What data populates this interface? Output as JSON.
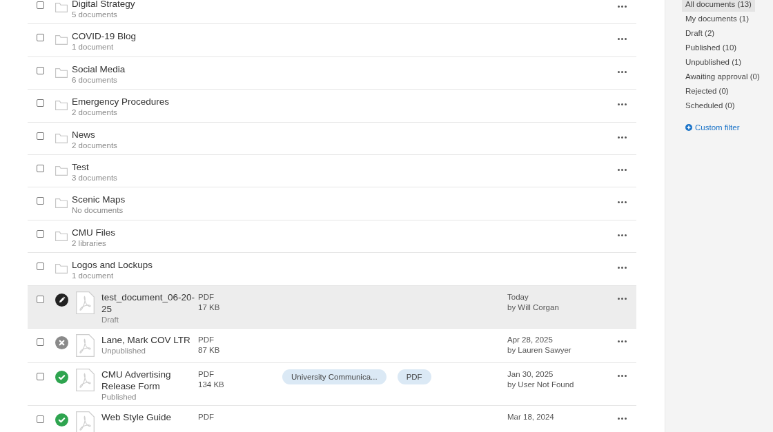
{
  "rows": [
    {
      "kind": "folder",
      "name": "Digital Strategy",
      "detail": "5 documents",
      "checked": false
    },
    {
      "kind": "folder",
      "name": "COVID-19 Blog",
      "detail": "1 document",
      "checked": false
    },
    {
      "kind": "folder",
      "name": "Social Media",
      "detail": "6 documents",
      "checked": false
    },
    {
      "kind": "folder",
      "name": "Emergency Procedures",
      "detail": "2 documents",
      "checked": false
    },
    {
      "kind": "folder",
      "name": "News",
      "detail": "2 documents",
      "checked": false
    },
    {
      "kind": "folder",
      "name": "Test",
      "detail": "3 documents",
      "checked": false
    },
    {
      "kind": "folder",
      "name": "Scenic Maps",
      "detail": "No documents",
      "checked": false
    },
    {
      "kind": "folder",
      "name": "CMU Files",
      "detail": "2 libraries",
      "checked": false
    },
    {
      "kind": "folder",
      "name": "Logos and Lockups",
      "detail": "1 document",
      "checked": false
    },
    {
      "kind": "draft",
      "name": "test_document_06-20-25",
      "detail": "Draft",
      "type": "PDF",
      "size": "17 KB",
      "tags": [],
      "date": "Today",
      "author": "by Will Corgan",
      "checked": false,
      "highlighted": true
    },
    {
      "kind": "unpublished",
      "name": "Lane, Mark COV LTR",
      "detail": "Unpublished",
      "type": "PDF",
      "size": "87 KB",
      "tags": [],
      "date": "Apr 28, 2025",
      "author": "by Lauren Sawyer",
      "checked": false,
      "highlighted": false
    },
    {
      "kind": "published",
      "name": "CMU Advertising Release Form",
      "detail": "Published",
      "type": "PDF",
      "size": "134 KB",
      "tags": [
        "University Communica...",
        "PDF"
      ],
      "date": "Jan 30, 2025",
      "author": "by User Not Found",
      "checked": false,
      "highlighted": false
    },
    {
      "kind": "published",
      "name": "Web Style Guide",
      "type": "PDF",
      "tags": [],
      "date": "Mar 18, 2024",
      "checked": false,
      "highlighted": false
    }
  ],
  "sidebar": {
    "filters": [
      {
        "label": "All documents (13)",
        "selected": true
      },
      {
        "label": "My documents (1)",
        "selected": false
      },
      {
        "label": "Draft (2)",
        "selected": false
      },
      {
        "label": "Published (10)",
        "selected": false
      },
      {
        "label": "Unpublished (1)",
        "selected": false
      },
      {
        "label": "Awaiting approval (0)",
        "selected": false
      },
      {
        "label": "Rejected (0)",
        "selected": false
      },
      {
        "label": "Scheduled (0)",
        "selected": false
      }
    ],
    "custom_filter": "Custom filter"
  }
}
